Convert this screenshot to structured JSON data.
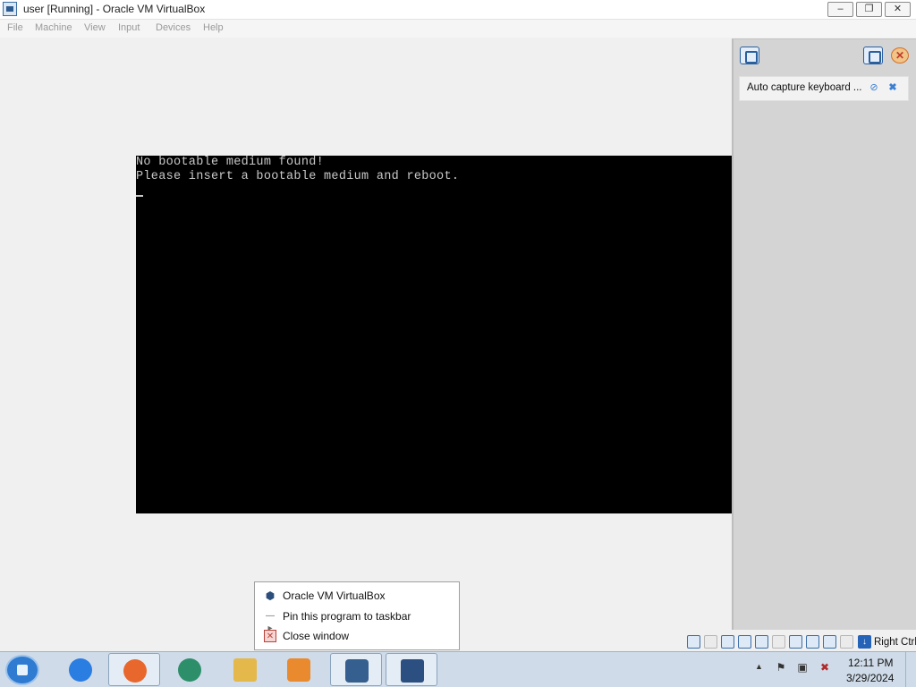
{
  "window": {
    "title": "user [Running] - Oracle VM VirtualBox",
    "controls": {
      "minimize": "–",
      "maximize": "❐",
      "close": "✕"
    }
  },
  "menubar": [
    "File",
    "Machine",
    "View",
    "Input",
    "Devices",
    "Help"
  ],
  "vm_screen": {
    "lines": [
      "No bootable medium found!",
      "Please insert a bootable medium and reboot."
    ]
  },
  "notification_panel": {
    "message": "Auto capture keyboard ...",
    "mute_glyph": "⊘",
    "dismiss_glyph": "✖"
  },
  "statusbar": {
    "host_key": "Right Ctrl",
    "host_key_glyph": "↓"
  },
  "jumplist": {
    "items": [
      {
        "label": "Oracle VM VirtualBox",
        "icon": "virtualbox-icon",
        "glyph": "⬢"
      },
      {
        "label": "Pin this program to taskbar",
        "icon": "pin-icon",
        "glyph": "—▸"
      },
      {
        "label": "Close window",
        "icon": "close-icon",
        "glyph": "✕"
      }
    ]
  },
  "taskbar": {
    "tray": {
      "arrow": "▲",
      "flag": "⚑",
      "network": "▣",
      "volume": "✖"
    },
    "clock": {
      "time": "12:11 PM",
      "date": "3/29/2024"
    }
  },
  "colors": {
    "vm_background": "#000000",
    "vm_text": "#c8c8c8",
    "panel_background": "#d4d4d4",
    "taskbar": "#cfdbe8"
  }
}
